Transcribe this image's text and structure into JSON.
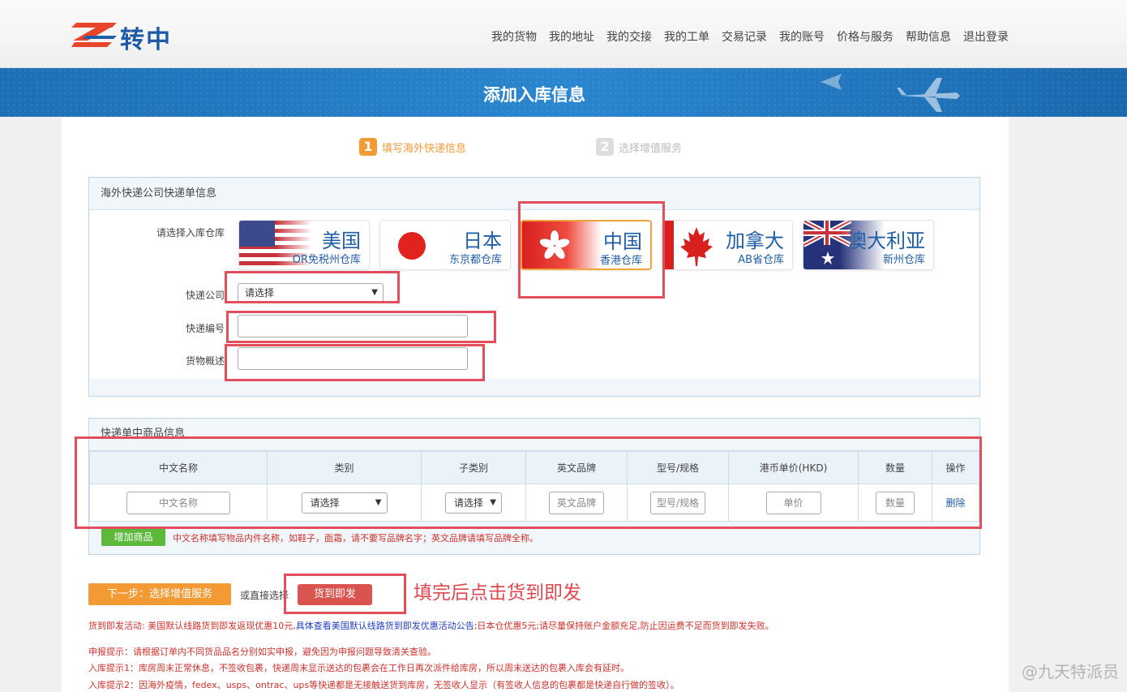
{
  "header": {
    "logo_text": "转中",
    "nav": [
      "我的货物",
      "我的地址",
      "我的交接",
      "我的工单",
      "交易记录",
      "我的账号",
      "价格与服务",
      "帮助信息",
      "退出登录"
    ]
  },
  "banner": {
    "title": "添加入库信息"
  },
  "steps": [
    {
      "num": "1",
      "label": "填写海外快递信息"
    },
    {
      "num": "2",
      "label": "选择增值服务"
    }
  ],
  "express_panel": {
    "title": "海外快递公司快递单信息",
    "warehouse_label": "请选择入库仓库",
    "warehouses": [
      {
        "name": "美国",
        "sub": "OR免税州仓库"
      },
      {
        "name": "日本",
        "sub": "东京都仓库"
      },
      {
        "name": "中国",
        "sub": "香港仓库"
      },
      {
        "name": "加拿大",
        "sub": "AB省仓库"
      },
      {
        "name": "澳大利亚",
        "sub": "新州仓库"
      }
    ],
    "courier_label": "快递公司",
    "courier_value": "请选择",
    "tracking_label": "快递编号",
    "desc_label": "货物概述"
  },
  "goods_panel": {
    "title": "快递单中商品信息",
    "columns": [
      "中文名称",
      "类别",
      "子类别",
      "英文品牌",
      "型号/规格",
      "港币单价(HKD)",
      "数量",
      "操作"
    ],
    "row": {
      "cn_name_placeholder": "中文名称",
      "category": "请选择",
      "subcategory": "请选择",
      "brand_placeholder": "英文品牌",
      "model_placeholder": "型号/规格",
      "price_placeholder": "单价",
      "qty_placeholder": "数量",
      "delete": "删除"
    },
    "add_button": "增加商品",
    "hint": "中文名称填写物品内件名称，如鞋子，面霜，请不要写品牌名字；英文品牌请填写品牌全称。"
  },
  "actions": {
    "next_button": "下一步：选择增值服务",
    "or_text": "或直接选择",
    "ship_button": "货到即发",
    "annotation": "填完后点击货到即发"
  },
  "notices": {
    "promo_prefix": "货到即发活动: 美国默认线路货到即发返现优惠10元,",
    "promo_link": "具体查看美国默认线路货到即发优惠活动公告",
    "promo_suffix": ";日本仓优惠5元;请尽量保持账户金额充足,防止因运费不足而货到即发失败。",
    "declare": "申报提示：请根据订单内不同货品品名分别如实申报，避免因为申报问题导致清关查验。",
    "tip1": "入库提示1：库房周末正常休息，不签收包裹，快递周末显示送达的包裹会在工作日再次派件给库房，所以周末送达的包裹入库会有延时。",
    "tip2": "入库提示2：因海外疫情，fedex、usps、ontrac、ups等快递都是无接触送货到库房，无签收人显示（有签收人信息的包裹都是快递自行做的签收）。"
  },
  "watermark": "@九天特派员",
  "colors": {
    "brand_blue": "#1f5ea8",
    "accent_orange": "#f39a35",
    "danger_red": "#d9534f",
    "annotation_red": "#e24f5a",
    "add_green": "#5cb93c"
  }
}
